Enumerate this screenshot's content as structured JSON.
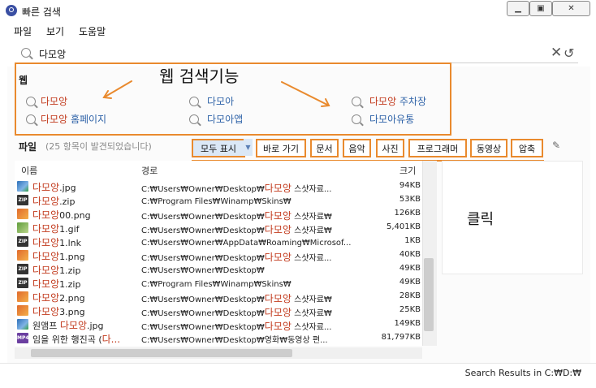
{
  "window": {
    "title": "빠른 검색"
  },
  "menu": [
    "파일",
    "보기",
    "도움말"
  ],
  "search": {
    "query": "다모앙"
  },
  "web": {
    "heading": "웹",
    "annotation": "웹 검색기능",
    "items": [
      {
        "hl": "다모앙",
        "rest": ""
      },
      {
        "hl": "다모앙",
        "rest": " 홈페이지"
      },
      {
        "hl": "",
        "rest": "다모아"
      },
      {
        "hl": "",
        "rest": "다모아앱"
      },
      {
        "hl": "다모앙",
        "rest": " 주차장"
      },
      {
        "hl": "",
        "rest": "다모아유통"
      }
    ]
  },
  "files": {
    "heading": "파일",
    "count": "(25 항목이 발견되었습니다)",
    "filters": [
      "모두 표시",
      "바로 가기",
      "문서",
      "음악",
      "사진",
      "프로그래머",
      "동영상",
      "압축"
    ],
    "columns": {
      "name": "이름",
      "path": "경로",
      "size": "크기"
    },
    "rows": [
      {
        "icon": "jpg",
        "pre": "",
        "hl": "다모앙",
        "post": ".jpg",
        "path_pre": "C:₩Users₩Owner₩Desktop₩",
        "path_hl": "다모앙",
        "path_post": " 스샷자료...",
        "size": "94KB"
      },
      {
        "icon": "zip",
        "pre": "",
        "hl": "다모앙",
        "post": ".zip",
        "path_pre": "C:₩Program Files₩Winamp₩Skins₩",
        "path_hl": "",
        "path_post": "",
        "size": "53KB"
      },
      {
        "icon": "png",
        "pre": "",
        "hl": "다모앙",
        "post": "00.png",
        "path_pre": "C:₩Users₩Owner₩Desktop₩",
        "path_hl": "다모앙",
        "path_post": " 스샷자료₩",
        "size": "126KB"
      },
      {
        "icon": "gif",
        "pre": "",
        "hl": "다모앙",
        "post": "1.gif",
        "path_pre": "C:₩Users₩Owner₩Desktop₩",
        "path_hl": "다모앙",
        "path_post": " 스샷자료₩",
        "size": "5,401KB"
      },
      {
        "icon": "zip",
        "pre": "",
        "hl": "다모앙",
        "post": "1.lnk",
        "path_pre": "C:₩Users₩Owner₩AppData₩Roaming₩Microsof...",
        "path_hl": "",
        "path_post": "",
        "size": "1KB"
      },
      {
        "icon": "png",
        "pre": "",
        "hl": "다모앙",
        "post": "1.png",
        "path_pre": "C:₩Users₩Owner₩Desktop₩",
        "path_hl": "다모앙",
        "path_post": " 스샷자료...",
        "size": "40KB"
      },
      {
        "icon": "zip",
        "pre": "",
        "hl": "다모앙",
        "post": "1.zip",
        "path_pre": "C:₩Users₩Owner₩Desktop₩",
        "path_hl": "",
        "path_post": "",
        "size": "49KB"
      },
      {
        "icon": "zip",
        "pre": "",
        "hl": "다모앙",
        "post": "1.zip",
        "path_pre": "C:₩Program Files₩Winamp₩Skins₩",
        "path_hl": "",
        "path_post": "",
        "size": "49KB"
      },
      {
        "icon": "png",
        "pre": "",
        "hl": "다모앙",
        "post": "2.png",
        "path_pre": "C:₩Users₩Owner₩Desktop₩",
        "path_hl": "다모앙",
        "path_post": " 스샷자료₩",
        "size": "28KB"
      },
      {
        "icon": "png",
        "pre": "",
        "hl": "다모앙",
        "post": "3.png",
        "path_pre": "C:₩Users₩Owner₩Desktop₩",
        "path_hl": "다모앙",
        "path_post": " 스샷자료₩",
        "size": "25KB"
      },
      {
        "icon": "jpg",
        "pre": "원앰프 ",
        "hl": "다모앙",
        "post": ".jpg",
        "path_pre": "C:₩Users₩Owner₩Desktop₩",
        "path_hl": "다모앙",
        "path_post": " 스샷자료...",
        "size": "149KB"
      },
      {
        "icon": "mp4",
        "pre": "임을 위한 행진곡 (",
        "hl": "다...",
        "post": "",
        "path_pre": "C:₩Users₩Owner₩Desktop₩영화₩동영상 편...",
        "path_hl": "",
        "path_post": "",
        "size": "81,797KB"
      }
    ]
  },
  "annotations": {
    "click": "클릭"
  },
  "status": {
    "text": "Search Results in C:₩D:₩"
  },
  "colors": {
    "annotation": "#e98a2e",
    "highlight": "#c23a1d",
    "link": "#2f63a8"
  }
}
